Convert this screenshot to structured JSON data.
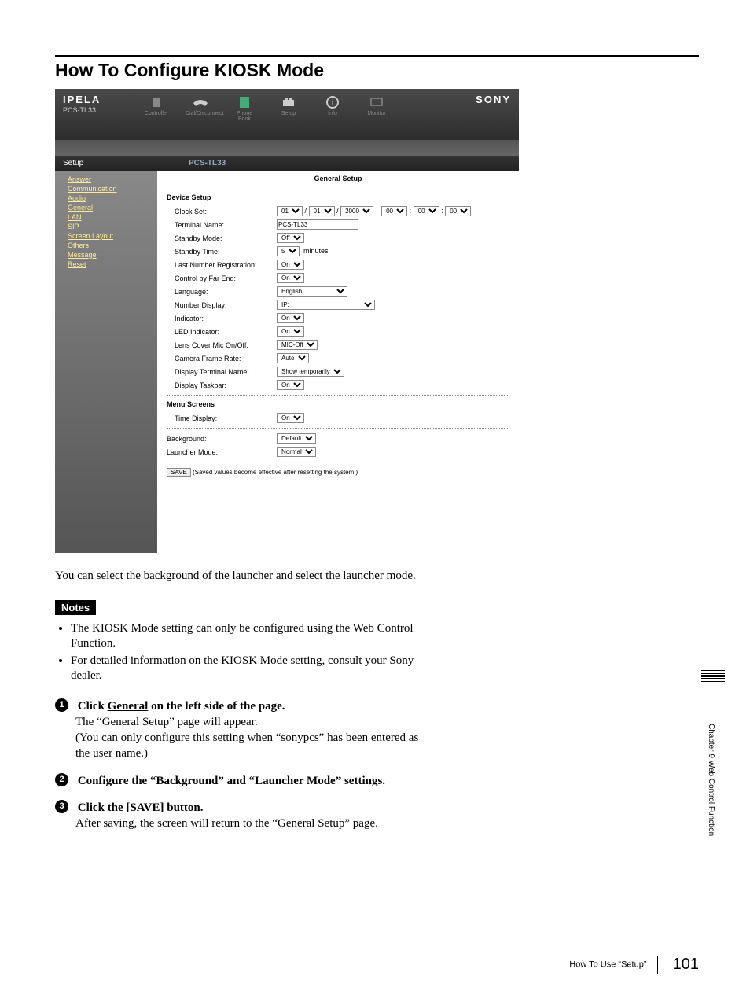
{
  "title": "How To Configure KIOSK Mode",
  "screenshot": {
    "brand": "IPELA",
    "model": "PCS-TL33",
    "maker": "SONY",
    "nav": [
      "Controller",
      "Dial/Disconnect",
      "Phone Book",
      "Setup",
      "Info",
      "Monitor"
    ],
    "setup_label": "Setup",
    "setup_model": "PCS-TL33",
    "sidebar": [
      "Answer",
      "Communication",
      "Audio",
      "General",
      "LAN",
      "SIP",
      "Screen Layout",
      "Others",
      "Message",
      "Reset"
    ],
    "content_title": "General Setup",
    "device_setup_head": "Device Setup",
    "clock_set": {
      "label": "Clock Set:",
      "m": "01",
      "d": "01",
      "y": "2000",
      "hh": "00",
      "mm": "00",
      "ss": "00",
      "sep1": "/",
      "sep2": "/",
      "sep3": ":",
      "sep4": ":"
    },
    "terminal_name": {
      "label": "Terminal Name:",
      "value": "PCS-TL33"
    },
    "standby_mode": {
      "label": "Standby Mode:",
      "value": "Off"
    },
    "standby_time": {
      "label": "Standby Time:",
      "value": "5",
      "unit": "minutes"
    },
    "last_number": {
      "label": "Last Number Registration:",
      "value": "On"
    },
    "control_far": {
      "label": "Control by Far End:",
      "value": "On"
    },
    "language": {
      "label": "Language:",
      "value": "English"
    },
    "number_display": {
      "label": "Number Display:",
      "value": "IP:"
    },
    "indicator": {
      "label": "Indicator:",
      "value": "On"
    },
    "led_indicator": {
      "label": "LED Indicator:",
      "value": "On"
    },
    "lens_cover": {
      "label": "Lens Cover Mic On/Off:",
      "value": "MIC-Off"
    },
    "camera_frame": {
      "label": "Camera Frame Rate:",
      "value": "Auto"
    },
    "display_terminal": {
      "label": "Display Terminal Name:",
      "value": "Show temporarily"
    },
    "display_taskbar": {
      "label": "Display Taskbar:",
      "value": "On"
    },
    "menu_screens_head": "Menu Screens",
    "time_display": {
      "label": "Time Display:",
      "value": "On"
    },
    "background": {
      "label": "Background:",
      "value": "Default"
    },
    "launcher_mode": {
      "label": "Launcher Mode:",
      "value": "Normal"
    },
    "save_button": "SAVE",
    "save_note": "(Saved values become effective after resetting the system.)"
  },
  "intro": "You can select the background of the launcher and select the launcher mode.",
  "notes_label": "Notes",
  "notes": [
    "The KIOSK Mode setting can only be configured using the Web Control Function.",
    "For detailed information on the KIOSK Mode setting, consult your Sony dealer."
  ],
  "steps": [
    {
      "num": "1",
      "head_pre": "Click ",
      "head_link": "General",
      "head_post": " on the left side of the page.",
      "body": "The “General Setup” page will appear.\n(You can only configure this setting when “sonypcs” has been entered as the user name.)"
    },
    {
      "num": "2",
      "head_pre": "Configure the “Background” and “Launcher Mode” settings.",
      "head_link": "",
      "head_post": "",
      "body": ""
    },
    {
      "num": "3",
      "head_pre": "Click the [SAVE] button.",
      "head_link": "",
      "head_post": "",
      "body": "After saving, the screen will return to the “General Setup” page."
    }
  ],
  "side_label": "Chapter 9  Web Control Function",
  "footer": {
    "text": "How To Use “Setup”",
    "page": "101"
  }
}
